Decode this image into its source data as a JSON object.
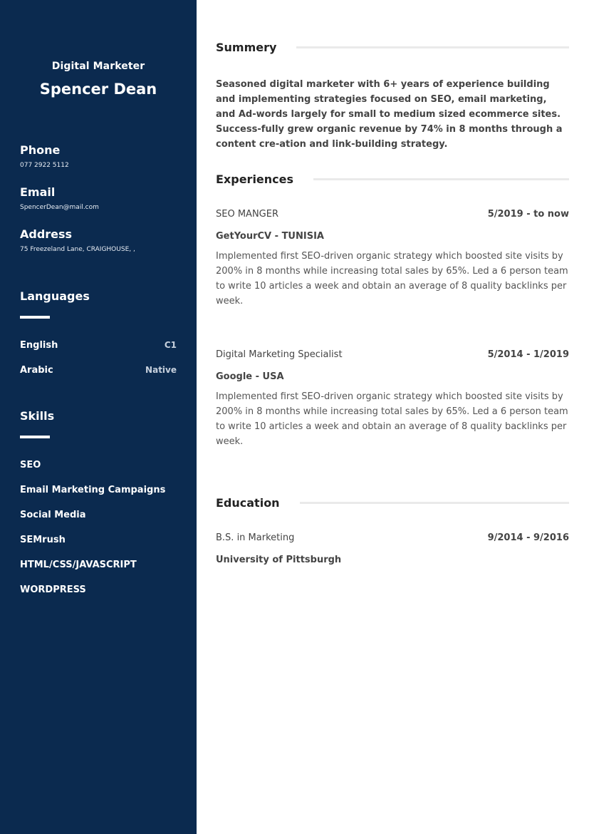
{
  "sidebar": {
    "job_title": "Digital Marketer",
    "name": "Spencer Dean",
    "contact": {
      "phone_label": "Phone",
      "phone": "077 2922 5112",
      "email_label": "Email",
      "email": "SpencerDean@mail.com",
      "address_label": "Address",
      "address": "75 Freezeland Lane, CRAIGHOUSE, ,"
    },
    "languages_title": "Languages",
    "languages": [
      {
        "name": "English",
        "level": "C1"
      },
      {
        "name": "Arabic",
        "level": "Native"
      }
    ],
    "skills_title": "Skills",
    "skills": [
      "SEO",
      "Email Marketing Campaigns",
      "Social Media",
      "SEMrush",
      "HTML/CSS/JAVASCRIPT",
      "WORDPRESS"
    ]
  },
  "main": {
    "summary_title": "Summery",
    "summary": "Seasoned digital marketer with 6+ years of experience building and implementing strategies focused on SEO, email marketing, and Ad-words largely for small to medium sized ecommerce sites. Success-fully grew organic revenue by 74% in 8 months through a content cre-ation and link-building strategy.",
    "experiences_title": "Experiences",
    "experiences": [
      {
        "role": "SEO MANGER",
        "dates": "5/2019 - to now",
        "org": "GetYourCV - TUNISIA",
        "desc": "Implemented first SEO-driven organic strategy which boosted site visits by 200% in 8 months while increasing total sales by 65%. Led a 6 person team to write 10 articles a week and obtain an average of 8 quality backlinks per week."
      },
      {
        "role": "Digital Marketing Specialist",
        "dates": "5/2014 - 1/2019",
        "org": "Google - USA",
        "desc": "Implemented first SEO-driven organic strategy which boosted site visits by 200% in 8 months while increasing total sales by 65%. Led a 6 person team to write 10 articles a week and obtain an average of 8 quality backlinks per week."
      }
    ],
    "education_title": "Education",
    "education": [
      {
        "degree": "B.S. in Marketing",
        "dates": "9/2014 - 9/2016",
        "school": "University of Pittsburgh"
      }
    ]
  },
  "colors": {
    "sidebar_bg": "#0b2a4f",
    "text_dark": "#444444",
    "rule": "#eaeaea"
  }
}
